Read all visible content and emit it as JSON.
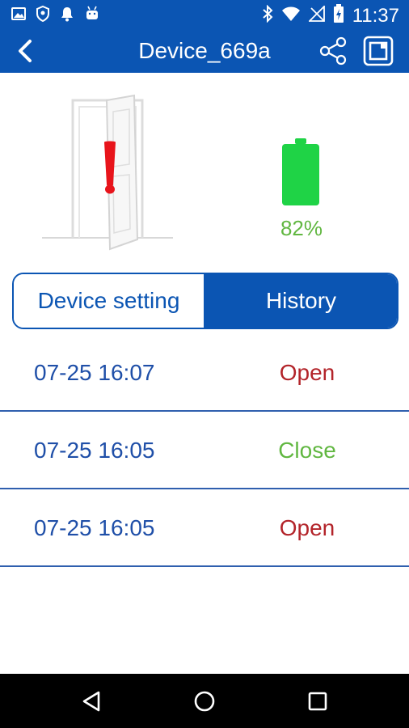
{
  "status_bar": {
    "time": "11:37",
    "icons_left": [
      "image-icon",
      "shield-icon",
      "bell-icon",
      "android-icon"
    ],
    "icons_right": [
      "bluetooth-icon",
      "wifi-icon",
      "no-signal-icon",
      "battery-charging-icon"
    ]
  },
  "app_bar": {
    "title": "Device_669a",
    "back_icon": "chevron-left-icon",
    "share_icon": "share-icon",
    "edit_icon": "edit-icon"
  },
  "device": {
    "door_state_icon": "open-door-alert-icon",
    "battery_level": 0.82,
    "battery_text": "82%"
  },
  "tabs": [
    {
      "label": "Device setting",
      "selected": false
    },
    {
      "label": "History",
      "selected": true
    }
  ],
  "history": [
    {
      "time": "07-25  16:07",
      "state": "Open"
    },
    {
      "time": "07-25  16:05",
      "state": "Close"
    },
    {
      "time": "07-25  16:05",
      "state": "Open"
    }
  ],
  "colors": {
    "primary": "#0b55b3",
    "open": "#b3242a",
    "close": "#61b741",
    "battery": "#1fd346",
    "time_text": "#1f4fa8"
  },
  "nav_bar": {
    "icons": [
      "back-triangle-icon",
      "home-circle-icon",
      "recents-square-icon"
    ]
  }
}
